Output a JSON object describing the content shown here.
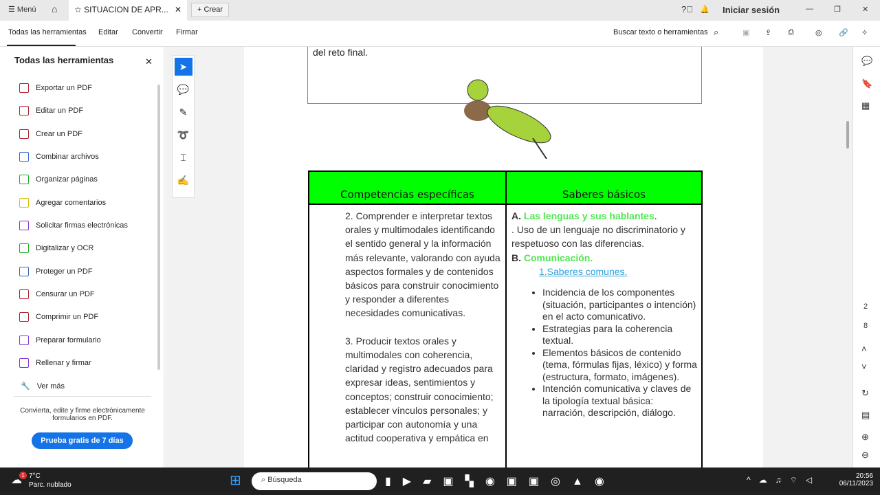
{
  "tabbar": {
    "menu": "Menú",
    "doc_title": "SITUACION DE APR...",
    "create": "Crear",
    "signin": "Iniciar sesión"
  },
  "menubar": {
    "items": [
      "Todas las herramientas",
      "Editar",
      "Convertir",
      "Firmar"
    ],
    "search": "Buscar texto o herramientas"
  },
  "panel": {
    "title": "Todas las herramientas",
    "tools": [
      "Exportar un PDF",
      "Editar un PDF",
      "Crear un PDF",
      "Combinar archivos",
      "Organizar páginas",
      "Agregar comentarios",
      "Solicitar firmas electrónicas",
      "Digitalizar y OCR",
      "Proteger un PDF",
      "Censurar un PDF",
      "Comprimir un PDF",
      "Preparar formulario",
      "Rellenar y firmar",
      "Ver más"
    ],
    "promo": "Convierta, edite y firme electrónicamente formularios en PDF.",
    "trial_button": "Prueba gratis de 7 días",
    "accent": "#1473e6"
  },
  "doc": {
    "top_text": "del reto final.",
    "headers": [
      "Competencias específicas",
      "Saberes básicos"
    ],
    "left": [
      "2. Comprender e interpretar textos orales y multimodales identificando el sentido general y la información más relevante, valorando con ayuda aspectos formales y de contenidos básicos para construir conocimiento y responder a diferentes necesidades comunicativas.",
      "3. Producir textos orales y multimodales con coherencia, claridad y registro adecuados para expresar  ideas, sentimientos y conceptos; construir conocimiento; establecer vínculos personales; y participar con autonomía y una actitud cooperativa y empática en"
    ],
    "a_label": "A.",
    "a_title": "Las lenguas y sus hablantes",
    "a_text": ". Uso de un lenguaje no discriminatorio y respetuoso con las diferencias.",
    "b_label": "B.",
    "b_title": "Comunicación.",
    "link": "1.Saberes comunes.",
    "bullets": [
      "Incidencia de los componentes (situación, participantes o intención) en el acto comunicativo.",
      "Estrategias para la coherencia textual.",
      "Elementos básicos de contenido (tema, fórmulas fijas, léxico) y forma (estructura, formato, imágenes).",
      "Intención comunicativa y claves de la tipología textual básica: narración, descripción, diálogo."
    ],
    "header_color": "#00ff00"
  },
  "rail": {
    "page_current": "2",
    "page_total": "8"
  },
  "taskbar": {
    "temp": "7°C",
    "weather": "Parc. nublado",
    "search": "Búsqueda",
    "time": "20:56",
    "date": "06/11/2023",
    "badge": "1"
  }
}
